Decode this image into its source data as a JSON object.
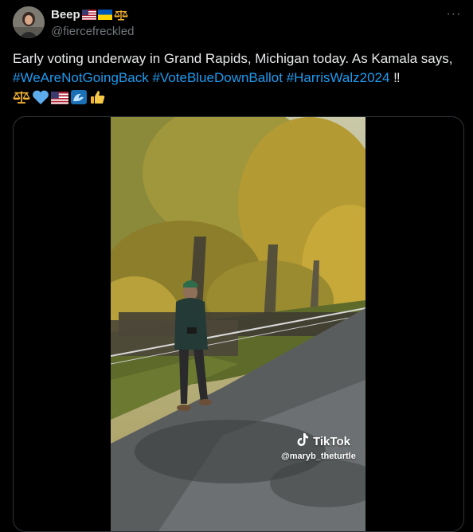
{
  "post": {
    "display_name": "Beep",
    "name_emojis": [
      "us-flag-emoji",
      "ukraine-flag-emoji",
      "scales-emoji"
    ],
    "handle": "@fiercefreckled",
    "more_label": "···",
    "text_main": "Early voting underway in Grand Rapids, Michigan today.  As Kamala says, ",
    "hashtags": [
      "#WeAreNotGoingBack",
      "#VoteBlueDownBallot",
      "#HarrisWalz2024"
    ],
    "text_end": " ‼",
    "trailing_emojis": [
      "scales-emoji",
      "blue-heart-emoji",
      "us-flag-emoji",
      "wave-emoji",
      "thumbs-up-emoji"
    ]
  },
  "media": {
    "watermark_brand": "TikTok",
    "watermark_handle": "@maryb_theturtle"
  },
  "colors": {
    "background": "#000000",
    "text": "#e7e9ea",
    "secondary": "#71767b",
    "link": "#1d9bf0",
    "border": "#2f3336"
  }
}
